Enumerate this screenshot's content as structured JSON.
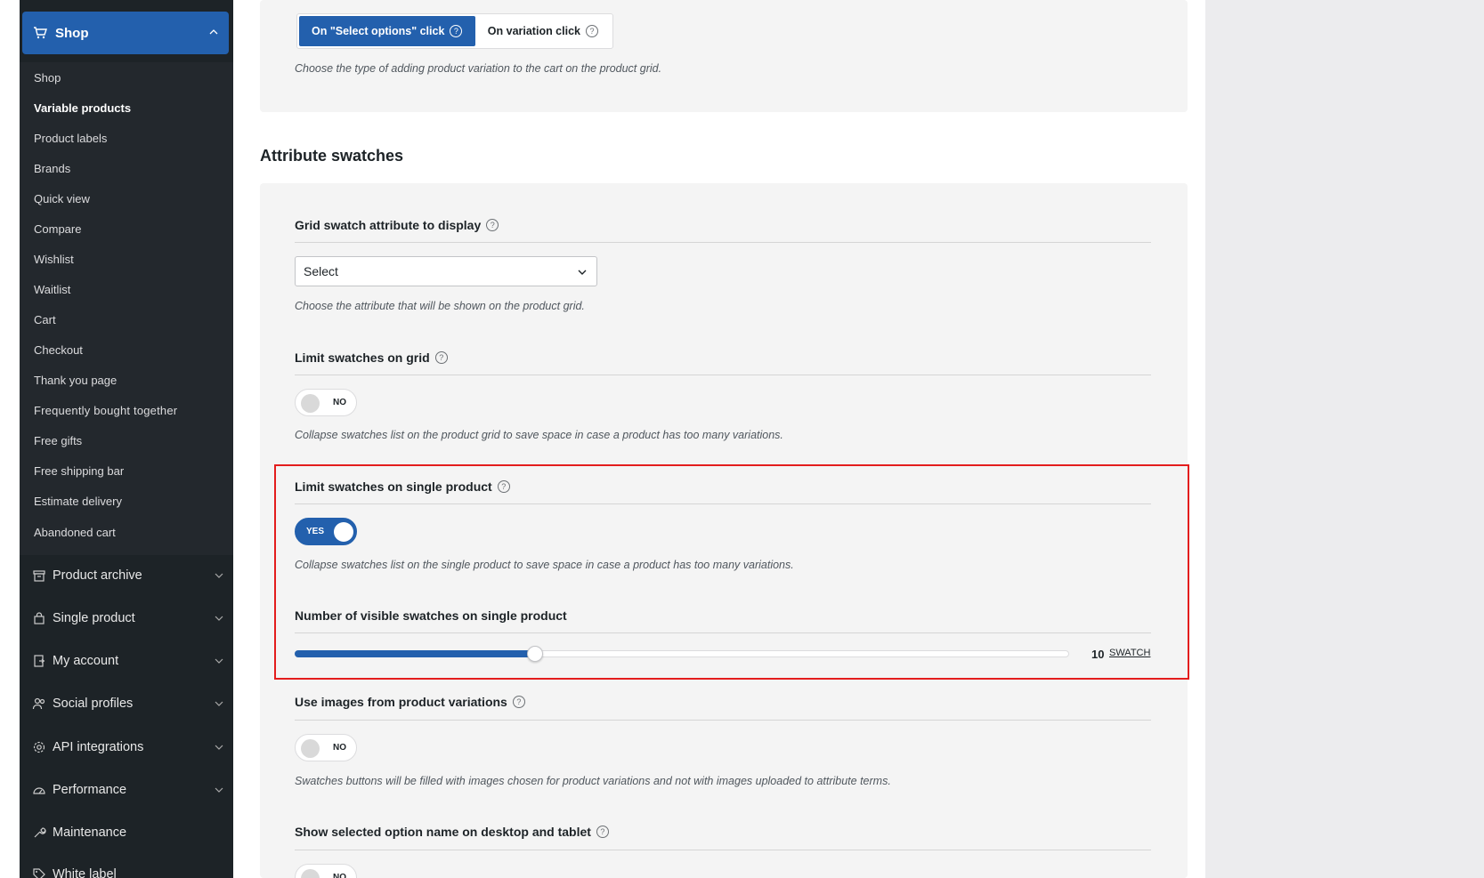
{
  "sidebar": {
    "shop_header": "Shop",
    "shop_items": [
      {
        "label": "Shop",
        "active": false
      },
      {
        "label": "Variable products",
        "active": true
      },
      {
        "label": "Product labels",
        "active": false
      },
      {
        "label": "Brands",
        "active": false
      },
      {
        "label": "Quick view",
        "active": false
      },
      {
        "label": "Compare",
        "active": false
      },
      {
        "label": "Wishlist",
        "active": false
      },
      {
        "label": "Waitlist",
        "active": false
      },
      {
        "label": "Cart",
        "active": false
      },
      {
        "label": "Checkout",
        "active": false
      },
      {
        "label": "Thank you page",
        "active": false
      },
      {
        "label": "Frequently bought together",
        "active": false
      },
      {
        "label": "Free gifts",
        "active": false
      },
      {
        "label": "Free shipping bar",
        "active": false
      },
      {
        "label": "Estimate delivery",
        "active": false
      },
      {
        "label": "Abandoned cart",
        "active": false
      }
    ],
    "sections": [
      {
        "label": "Product archive",
        "icon": "archive-icon"
      },
      {
        "label": "Single product",
        "icon": "bag-icon"
      },
      {
        "label": "My account",
        "icon": "account-icon"
      },
      {
        "label": "Social profiles",
        "icon": "users-icon"
      },
      {
        "label": "API integrations",
        "icon": "gear-icon"
      },
      {
        "label": "Performance",
        "icon": "gauge-icon"
      },
      {
        "label": "Maintenance",
        "icon": "wrench-icon"
      },
      {
        "label": "White label",
        "icon": "tag-icon"
      }
    ]
  },
  "top_panel": {
    "option_select": "On \"Select options\" click",
    "option_variation": "On variation click",
    "description": "Choose the type of adding product variation to the cart on the product grid."
  },
  "attribute_swatches": {
    "title": "Attribute swatches",
    "grid_swatch": {
      "label": "Grid swatch attribute to display",
      "select_value": "Select",
      "description": "Choose the attribute that will be shown on the product grid."
    },
    "limit_grid": {
      "label": "Limit swatches on grid",
      "toggle": "NO",
      "description": "Collapse swatches list on the product grid to save space in case a product has too many variations."
    },
    "limit_single": {
      "label": "Limit swatches on single product",
      "toggle": "YES",
      "description": "Collapse swatches list on the single product to save space in case a product has too many variations."
    },
    "visible_swatches": {
      "label": "Number of visible swatches on single product",
      "value": "10",
      "unit": "SWATCH",
      "fraction": 0.31
    },
    "variation_images": {
      "label": "Use images from product variations",
      "toggle": "NO",
      "description": "Swatches buttons will be filled with images chosen for product variations and not with images uploaded to attribute terms."
    },
    "show_option_name": {
      "label": "Show selected option name on desktop and tablet",
      "toggle": "NO"
    }
  },
  "colors": {
    "accent": "#2360ad",
    "sidebar_bg": "#1d2327",
    "highlight": "#e31d1d"
  }
}
